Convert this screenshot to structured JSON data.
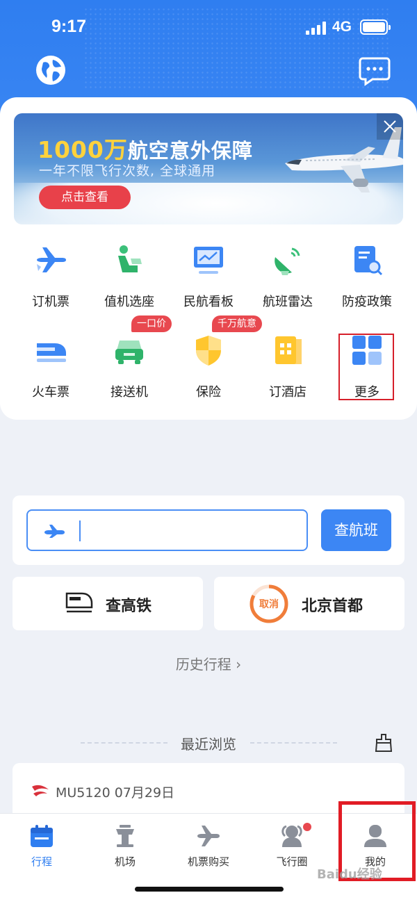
{
  "status_bar": {
    "time": "9:17",
    "network": "4G"
  },
  "banner": {
    "title_number": "1000万",
    "title_rest": "航空意外保障",
    "subtitle": "一年不限飞行次数, 全球通用",
    "button": "点击查看"
  },
  "services": [
    {
      "label": "订机票",
      "icon": "plane-icon"
    },
    {
      "label": "值机选座",
      "icon": "seat-icon"
    },
    {
      "label": "民航看板",
      "icon": "dashboard-icon"
    },
    {
      "label": "航班雷达",
      "icon": "radar-icon"
    },
    {
      "label": "防疫政策",
      "icon": "policy-doc-icon"
    },
    {
      "label": "火车票",
      "icon": "train-icon"
    },
    {
      "label": "接送机",
      "icon": "car-icon",
      "tag": "一口价"
    },
    {
      "label": "保险",
      "icon": "shield-icon",
      "tag": "千万航意"
    },
    {
      "label": "订酒店",
      "icon": "hotel-icon"
    },
    {
      "label": "更多",
      "icon": "more-grid-icon"
    }
  ],
  "search": {
    "button": "查航班"
  },
  "quick_links": {
    "train": "查高铁",
    "badge": "取消",
    "airport": "北京首都"
  },
  "history": "历史行程 ›",
  "recent": {
    "title": "最近浏览",
    "flight": "MU5120 07月29日"
  },
  "tabs": [
    {
      "label": "行程",
      "icon": "calendar-icon",
      "active": true
    },
    {
      "label": "机场",
      "icon": "airport-tower-icon"
    },
    {
      "label": "机票购买",
      "icon": "plane-icon"
    },
    {
      "label": "飞行圈",
      "icon": "community-icon"
    },
    {
      "label": "我的",
      "icon": "user-icon"
    }
  ],
  "watermark": "Baidu经验",
  "colors": {
    "primary": "#2f7ef0",
    "accent_red": "#e8484f",
    "highlight": "#e11c25"
  }
}
